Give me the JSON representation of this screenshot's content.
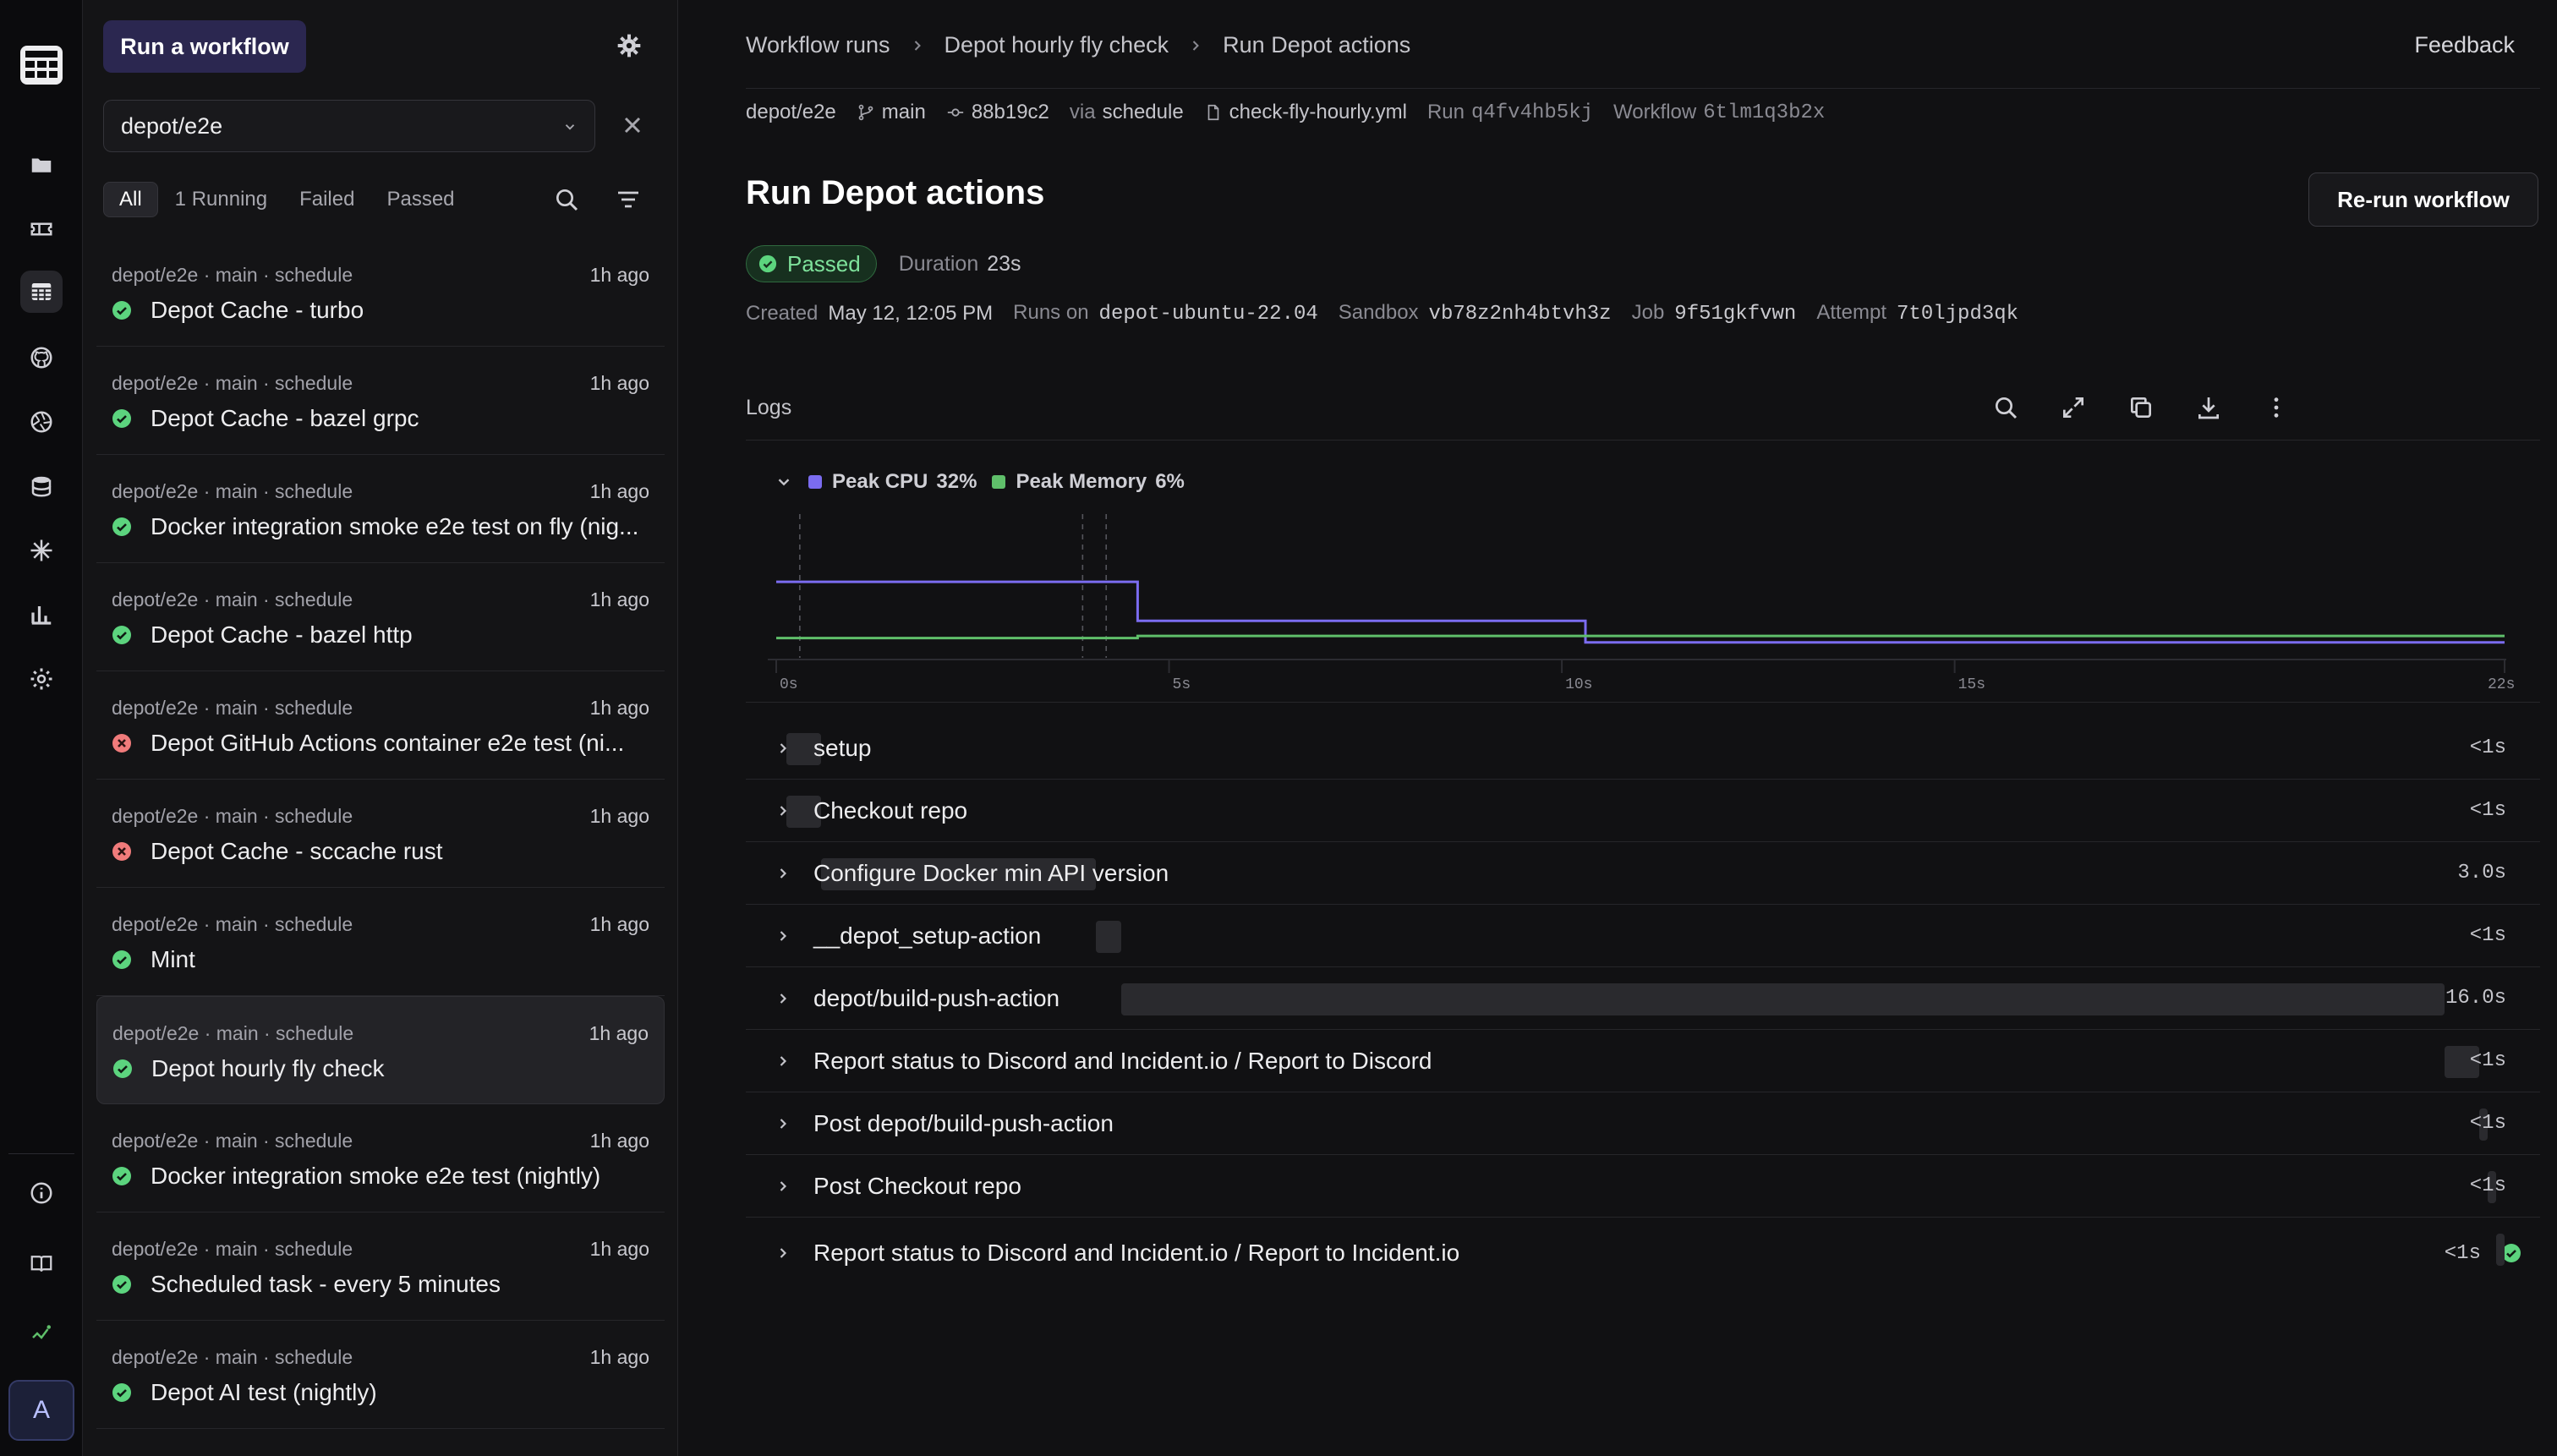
{
  "sidebar": {
    "run_button": "Run a workflow",
    "repo_filter": "depot/e2e",
    "filters": [
      "All",
      "1 Running",
      "Failed",
      "Passed"
    ],
    "runs": [
      {
        "meta": "depot/e2e · main · schedule",
        "time": "1h ago",
        "title": "Depot Cache - turbo",
        "status": "passed"
      },
      {
        "meta": "depot/e2e · main · schedule",
        "time": "1h ago",
        "title": "Depot Cache - bazel grpc",
        "status": "passed"
      },
      {
        "meta": "depot/e2e · main · schedule",
        "time": "1h ago",
        "title": "Docker integration smoke e2e test on fly (nig...",
        "status": "passed"
      },
      {
        "meta": "depot/e2e · main · schedule",
        "time": "1h ago",
        "title": "Depot Cache - bazel http",
        "status": "passed"
      },
      {
        "meta": "depot/e2e · main · schedule",
        "time": "1h ago",
        "title": "Depot GitHub Actions container e2e test (ni...",
        "status": "failed"
      },
      {
        "meta": "depot/e2e · main · schedule",
        "time": "1h ago",
        "title": "Depot Cache - sccache rust",
        "status": "failed"
      },
      {
        "meta": "depot/e2e · main · schedule",
        "time": "1h ago",
        "title": "Mint",
        "status": "passed"
      },
      {
        "meta": "depot/e2e · main · schedule",
        "time": "1h ago",
        "title": "Depot hourly fly check",
        "status": "passed"
      },
      {
        "meta": "depot/e2e · main · schedule",
        "time": "1h ago",
        "title": "Docker integration smoke e2e test (nightly)",
        "status": "passed"
      },
      {
        "meta": "depot/e2e · main · schedule",
        "time": "1h ago",
        "title": "Scheduled task - every 5 minutes",
        "status": "passed"
      },
      {
        "meta": "depot/e2e · main · schedule",
        "time": "1h ago",
        "title": "Depot AI test (nightly)",
        "status": "passed"
      }
    ]
  },
  "rail": {
    "avatar": "A"
  },
  "header": {
    "breadcrumb": [
      "Workflow runs",
      "Depot hourly fly check",
      "Run Depot actions"
    ],
    "feedback": "Feedback"
  },
  "meta": {
    "repo": "depot/e2e",
    "branch": "main",
    "commit": "88b19c2",
    "via_label": "via",
    "via": "schedule",
    "file": "check-fly-hourly.yml",
    "run_label": "Run",
    "run_id": "q4fv4hb5kj",
    "workflow_label": "Workflow",
    "workflow_id": "6tlm1q3b2x"
  },
  "run": {
    "title": "Run Depot actions",
    "rerun_button": "Re-run workflow",
    "status": "Passed",
    "duration_label": "Duration",
    "duration": "23s",
    "details": [
      {
        "label": "Created",
        "value": "May 12, 12:05 PM",
        "mono": false
      },
      {
        "label": "Runs on",
        "value": "depot-ubuntu-22.04",
        "mono": true
      },
      {
        "label": "Sandbox",
        "value": "vb78z2nh4btvh3z",
        "mono": true
      },
      {
        "label": "Job",
        "value": "9f51gkfvwn",
        "mono": true
      },
      {
        "label": "Attempt",
        "value": "7t0ljpd3qk",
        "mono": true
      }
    ]
  },
  "logs": {
    "label": "Logs"
  },
  "colors": {
    "cpu": "#7b6cf0",
    "memory": "#5fbf6a",
    "passed": "#5cd47e",
    "failed": "#f07b7b"
  },
  "chart_data": {
    "type": "line",
    "x_ticks": [
      "0s",
      "5s",
      "10s",
      "15s",
      "22s"
    ],
    "xlim": [
      0,
      22
    ],
    "ylim": [
      0,
      100
    ],
    "series": [
      {
        "name": "Peak CPU",
        "peak_label": "32%",
        "x": [
          0,
          4.6,
          4.6,
          10.3,
          10.3,
          22
        ],
        "y": [
          32,
          32,
          14,
          14,
          4,
          4
        ]
      },
      {
        "name": "Peak Memory",
        "peak_label": "6%",
        "x": [
          0,
          4.6,
          4.6,
          22
        ],
        "y": [
          6,
          6,
          7,
          7
        ]
      }
    ],
    "markers_x": [
      0.3,
      3.9,
      4.2
    ]
  },
  "steps": [
    {
      "name": "setup",
      "duration": "<1s",
      "bar_start": 0.0,
      "bar_end": 0.02
    },
    {
      "name": "Checkout repo",
      "duration": "<1s",
      "bar_start": 0.0,
      "bar_end": 0.02
    },
    {
      "name": "Configure Docker min API version",
      "duration": "3.0s",
      "bar_start": 0.02,
      "bar_end": 0.18
    },
    {
      "name": "__depot_setup-action",
      "duration": "<1s",
      "bar_start": 0.18,
      "bar_end": 0.195
    },
    {
      "name": "depot/build-push-action",
      "duration": "16.0s",
      "bar_start": 0.195,
      "bar_end": 0.965
    },
    {
      "name": "Report status to Discord and Incident.io / Report to Discord",
      "duration": "<1s",
      "bar_start": 0.965,
      "bar_end": 0.985
    },
    {
      "name": "Post depot/build-push-action",
      "duration": "<1s",
      "bar_start": 0.985,
      "bar_end": 0.99
    },
    {
      "name": "Post Checkout repo",
      "duration": "<1s",
      "bar_start": 0.99,
      "bar_end": 0.995
    },
    {
      "name": "Report status to Discord and Incident.io / Report to Incident.io",
      "duration": "<1s",
      "bar_start": 0.995,
      "bar_end": 1.0,
      "final": true
    }
  ]
}
